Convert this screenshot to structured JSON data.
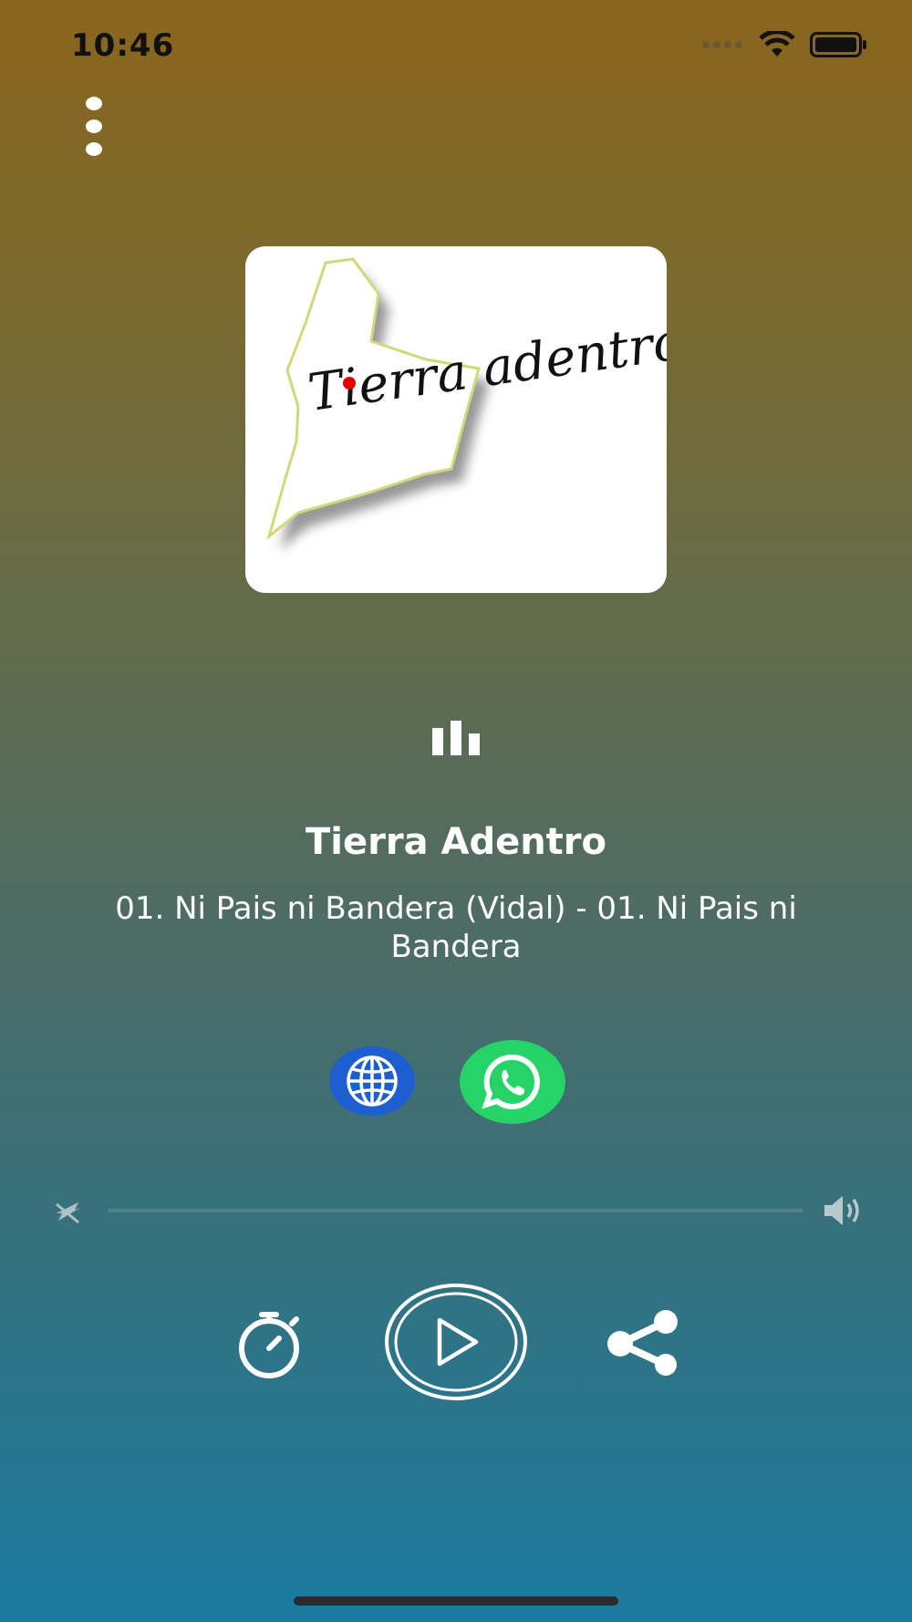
{
  "status_bar": {
    "time": "10:46",
    "icons": [
      "signal-dots-icon",
      "wifi-icon",
      "battery-icon"
    ]
  },
  "menu": {
    "icon": "more-vertical-icon"
  },
  "logo": {
    "text": "Tierra adentro",
    "accent_color": "#e00000"
  },
  "player": {
    "station_name": "Tierra Adentro",
    "track_title": "01. Ni Pais ni Bandera (Vidal) - 01. Ni Pais ni Bandera",
    "state_icon": "equalizer-icon"
  },
  "links": {
    "website_icon": "globe-icon",
    "whatsapp_icon": "whatsapp-icon",
    "website_color": "#1d5fd1",
    "whatsapp_color": "#25d366"
  },
  "volume": {
    "min_icon": "volume-mute-icon",
    "max_icon": "volume-up-icon"
  },
  "controls": {
    "timer_icon": "timer-icon",
    "play_icon": "play-icon",
    "share_icon": "share-icon"
  },
  "colors": {
    "gradient_top": "#8a651d",
    "gradient_bottom": "#1c7aa0"
  }
}
